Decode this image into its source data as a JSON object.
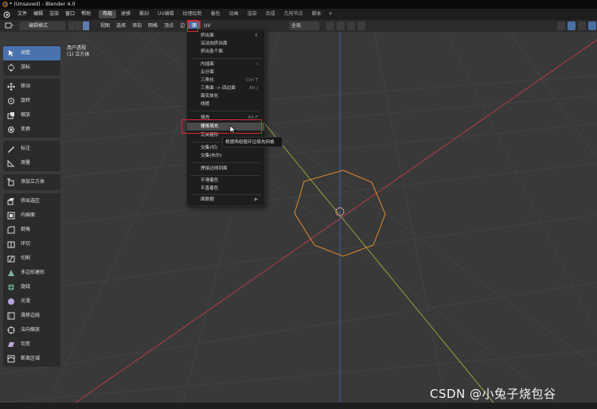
{
  "window": {
    "title": "* (Unsaved) - Blender 4.0"
  },
  "menu_bar": {
    "items": [
      "文件",
      "编辑",
      "渲染",
      "窗口",
      "帮助"
    ]
  },
  "workspace_tabs": [
    {
      "label": "布局",
      "active": true
    },
    {
      "label": "建模"
    },
    {
      "label": "雕刻"
    },
    {
      "label": "UV编辑"
    },
    {
      "label": "纹理绘制"
    },
    {
      "label": "着色"
    },
    {
      "label": "动画"
    },
    {
      "label": "渲染"
    },
    {
      "label": "合成"
    },
    {
      "label": "几何节点"
    },
    {
      "label": "脚本"
    },
    {
      "label": "+"
    }
  ],
  "header": {
    "mode": "编辑模式",
    "menus": [
      "视图",
      "选择",
      "添加",
      "网格",
      "顶点",
      "边",
      "面",
      "UV"
    ],
    "open_menu": "面",
    "transform_orientation": "全局"
  },
  "viewport": {
    "view_name": "用户透视",
    "object_name": "(1) 立方体"
  },
  "toolbar": {
    "groups": [
      [
        {
          "label": "调整",
          "icon": "tweak-icon",
          "active": true
        },
        {
          "label": "游标",
          "icon": "cursor-icon"
        }
      ],
      [
        {
          "label": "移动",
          "icon": "move-icon"
        },
        {
          "label": "旋转",
          "icon": "rotate-icon"
        },
        {
          "label": "缩放",
          "icon": "scale-icon"
        },
        {
          "label": "变换",
          "icon": "transform-icon"
        }
      ],
      [
        {
          "label": "标注",
          "icon": "annotate-icon"
        },
        {
          "label": "测量",
          "icon": "measure-icon"
        }
      ],
      [
        {
          "label": "添加立方体",
          "icon": "add-cube-icon"
        }
      ],
      [
        {
          "label": "挤出选区",
          "icon": "extrude-icon"
        },
        {
          "label": "内插面",
          "icon": "inset-icon"
        },
        {
          "label": "倒角",
          "icon": "bevel-icon"
        },
        {
          "label": "环切",
          "icon": "loop-cut-icon"
        },
        {
          "label": "切割",
          "icon": "knife-icon"
        },
        {
          "label": "多边形建形",
          "icon": "poly-build-icon"
        },
        {
          "label": "旋绕",
          "icon": "spin-icon"
        },
        {
          "label": "光滑",
          "icon": "smooth-icon"
        },
        {
          "label": "滑移边线",
          "icon": "edge-slide-icon"
        },
        {
          "label": "法向缩放",
          "icon": "shrink-fatten-icon"
        },
        {
          "label": "切变",
          "icon": "shear-icon"
        },
        {
          "label": "断离区域",
          "icon": "rip-region-icon"
        }
      ]
    ]
  },
  "face_menu": {
    "items": [
      {
        "label": "挤出面",
        "shortcut": "E"
      },
      {
        "label": "沿法向挤出面",
        "shortcut": ""
      },
      {
        "label": "挤出各个面",
        "shortcut": ""
      },
      {
        "separator": true
      },
      {
        "label": "内插面",
        "shortcut": "I"
      },
      {
        "label": "尖分面",
        "shortcut": ""
      },
      {
        "label": "三角化",
        "shortcut": "Ctrl T"
      },
      {
        "label": "三角面 -> 四边面",
        "shortcut": "Alt J"
      },
      {
        "label": "面实体化",
        "shortcut": ""
      },
      {
        "label": "线框",
        "shortcut": ""
      },
      {
        "separator": true
      },
      {
        "label": "填充",
        "shortcut": "Alt F"
      },
      {
        "label": "栅格填充",
        "shortcut": "",
        "highlighted": true
      },
      {
        "label": "完美建形",
        "shortcut": ""
      },
      {
        "separator": true
      },
      {
        "label": "交集(切)",
        "shortcut": ""
      },
      {
        "label": "交集(布尔)",
        "shortcut": ""
      },
      {
        "separator": true
      },
      {
        "label": "焊接边线到面",
        "shortcut": ""
      },
      {
        "separator": true
      },
      {
        "label": "平滑着色",
        "shortcut": ""
      },
      {
        "label": "平直着色",
        "shortcut": ""
      },
      {
        "separator": true
      },
      {
        "label": "面数据",
        "shortcut": "▶"
      }
    ]
  },
  "tooltip": {
    "text": "根据两组循环边填充网格."
  },
  "watermark": "CSDN @小兔子烧包谷",
  "colors": {
    "accent_blue": "#4a72ad",
    "highlight_red": "#e0262c",
    "x_axis": "#b53d45",
    "y_axis": "#8fa33a",
    "z_axis": "#3b63a8",
    "selection_orange": "#e08a2e"
  }
}
